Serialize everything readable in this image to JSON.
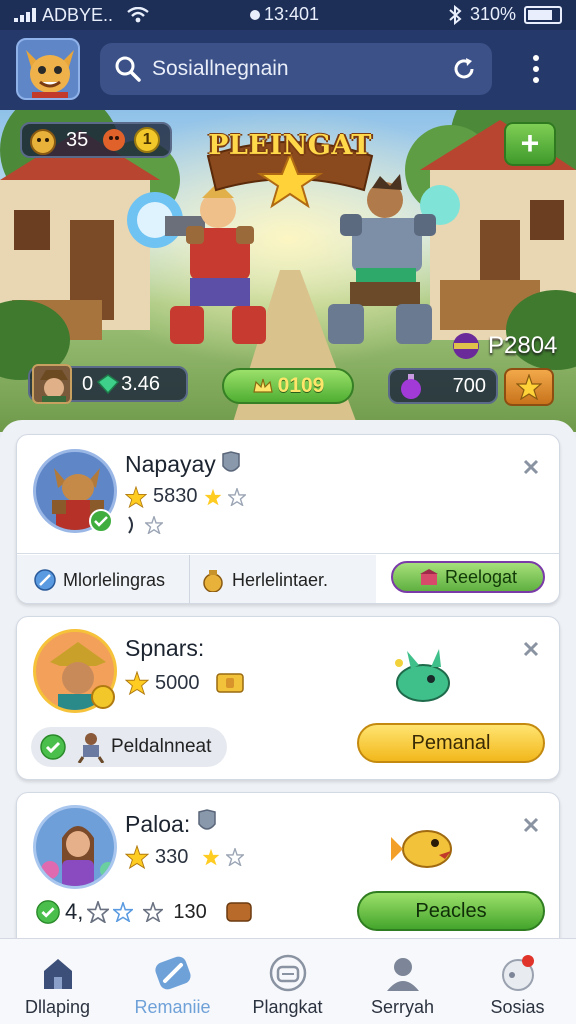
{
  "status_bar": {
    "carrier": "ADBYE..",
    "time": "13:401",
    "battery": "310%"
  },
  "header": {
    "search_text": "Sosiallnegnain"
  },
  "banner": {
    "title": "PLEINGAT",
    "coins": "35",
    "badge_count": "1",
    "gems": "0",
    "gems_value": "3.46",
    "gold": "0109",
    "points": "P2804",
    "potions": "700"
  },
  "cards": [
    {
      "name": "Napayay",
      "score": "5830",
      "tabs": [
        "Mlorlelingras",
        "Herlelintaer.",
        "Reelogat"
      ]
    },
    {
      "name": "Spnars:",
      "score": "5000",
      "chip": "Peldalnneat",
      "button": "Pemanal"
    },
    {
      "name": "Paloa:",
      "score": "330",
      "count": "4,",
      "count2": "130",
      "button": "Peacles"
    }
  ],
  "nav": [
    {
      "label": "Dllaping",
      "icon": "home-icon"
    },
    {
      "label": "Remaniie",
      "icon": "pencil-icon"
    },
    {
      "label": "Plangkat",
      "icon": "gamepad-icon"
    },
    {
      "label": "Serryah",
      "icon": "person-icon"
    },
    {
      "label": "Sosias",
      "icon": "notification-icon"
    }
  ],
  "colors": {
    "header": "#25396a",
    "accent": "#6fa1d9",
    "yellow_button": "#f2b81c",
    "green_button": "#44a52c"
  }
}
